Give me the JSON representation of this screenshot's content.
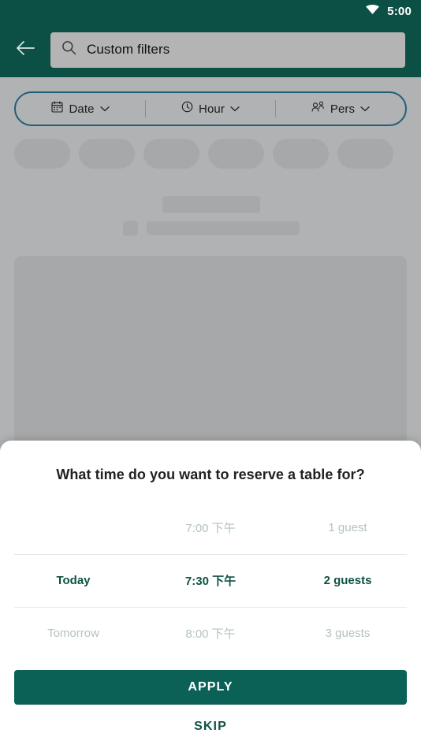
{
  "statusbar": {
    "time": "5:00",
    "wifi_icon": "wifi-icon"
  },
  "appbar": {
    "back_icon": "arrow-back-icon",
    "search_icon": "search-icon",
    "search_value": "Custom filters",
    "search_placeholder": "Search"
  },
  "filterbar": {
    "segments": [
      {
        "label": "Date",
        "icon": "calendar-icon",
        "chevron": "chevron-down-icon"
      },
      {
        "label": "Hour",
        "icon": "clock-icon",
        "chevron": "chevron-down-icon"
      },
      {
        "label": "Pers",
        "icon": "people-icon",
        "chevron": "chevron-down-icon"
      }
    ]
  },
  "skeleton": {
    "chip_count": 6
  },
  "sheet": {
    "title": "What time do you want to reserve a table for?",
    "rows": [
      {
        "day": "",
        "time": "7:00 下午",
        "guests": "1 guest",
        "selected": false
      },
      {
        "day": "Today",
        "time": "7:30 下午",
        "guests": "2 guests",
        "selected": true
      },
      {
        "day": "Tomorrow",
        "time": "8:00 下午",
        "guests": "3 guests",
        "selected": false
      }
    ],
    "apply_label": "APPLY",
    "skip_label": "SKIP"
  },
  "colors": {
    "brand_dark": "#0c4f45",
    "brand_button": "#0c6157",
    "selected_text": "#0f5244",
    "filter_border": "#1f5f7a",
    "dim_overlay": "#b0b2b3",
    "skeleton": "#a6a8a9"
  }
}
